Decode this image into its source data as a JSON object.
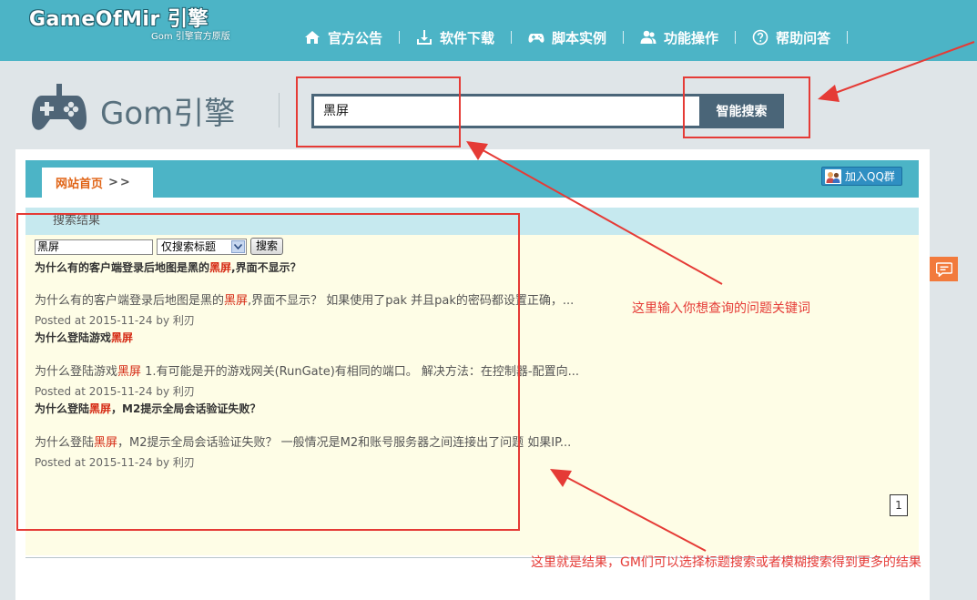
{
  "logo": {
    "main": "GameOfMir 引擎",
    "sub": "Gom 引擎官方原版"
  },
  "nav": [
    {
      "label": "官方公告",
      "icon": "home-icon"
    },
    {
      "label": "软件下载",
      "icon": "download-icon"
    },
    {
      "label": "脚本实例",
      "icon": "gamepad-icon"
    },
    {
      "label": "功能操作",
      "icon": "users-icon"
    },
    {
      "label": "帮助问答",
      "icon": "help-icon"
    }
  ],
  "header": {
    "brand": "Gom引擎"
  },
  "search": {
    "value": "黑屏",
    "button_label": "智能搜索"
  },
  "breadcrumb": {
    "home": "网站首页",
    "sep": ">>"
  },
  "qq": {
    "label": "加入QQ群"
  },
  "results": {
    "heading": "搜索结果",
    "form": {
      "keyword": "黑屏",
      "mode": "仅搜索标题",
      "submit": "搜索"
    },
    "items": [
      {
        "title_pre": "为什么有的客户端登录后地图是黑的",
        "title_hl": "黑屏",
        "title_post": ",界面不显示？",
        "snippet_pre": "为什么有的客户端登录后地图是黑的",
        "snippet_hl": "黑屏",
        "snippet_post": ",界面不显示？ 如果使用了pak 并且pak的密码都设置正确，...",
        "meta": "Posted at 2015-11-24 by 利刃"
      },
      {
        "title_pre": "为什么登陆游戏",
        "title_hl": "黑屏",
        "title_post": "",
        "snippet_pre": "为什么登陆游戏",
        "snippet_hl": "黑屏",
        "snippet_post": " 1.有可能是开的游戏网关(RunGate)有相同的端口。 解决方法：在控制器-配置向...",
        "meta": "Posted at 2015-11-24 by 利刃"
      },
      {
        "title_pre": "为什么登陆",
        "title_hl": "黑屏",
        "title_post": "，M2提示全局会话验证失败？",
        "snippet_pre": "为什么登陆",
        "snippet_hl": "黑屏",
        "snippet_post": "，M2提示全局会话验证失败？ 一般情况是M2和账号服务器之间连接出了问题 如果IP...",
        "meta": "Posted at 2015-11-24 by 利刃"
      }
    ],
    "page": "1"
  },
  "annotations": {
    "keyword_hint": "这里输入你想查询的问题关键词",
    "result_hint": "这里就是结果，GM们可以选择标题搜索或者模糊搜索得到更多的结果"
  },
  "colors": {
    "accent": "#4cb4c6",
    "search_dark": "#4a6578",
    "highlight": "#d52a14",
    "annotation": "#e53b36",
    "feedback": "#f27a3c"
  }
}
